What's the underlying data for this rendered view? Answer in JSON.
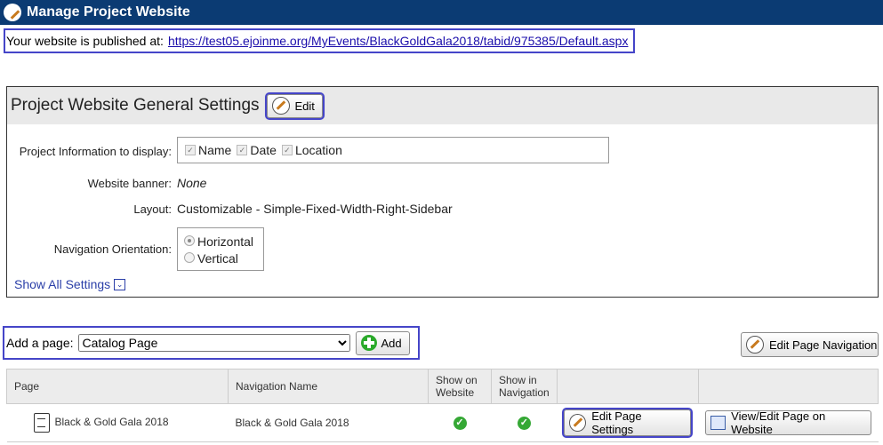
{
  "header": {
    "title": "Manage Project Website"
  },
  "publish": {
    "text": "Your website is published at:",
    "url": "https://test05.ejoinme.org/MyEvents/BlackGoldGala2018/tabid/975385/Default.aspx"
  },
  "general": {
    "title": "Project Website General Settings",
    "edit_label": "Edit",
    "info_label": "Project Information to display:",
    "info_options": [
      "Name",
      "Date",
      "Location"
    ],
    "banner_label": "Website banner:",
    "banner_value": "None",
    "layout_label": "Layout:",
    "layout_value": "Customizable - Simple-Fixed-Width-Right-Sidebar",
    "nav_label": "Navigation Orientation:",
    "nav_options": [
      "Horizontal",
      "Vertical"
    ],
    "show_all": "Show All Settings"
  },
  "addpage": {
    "label": "Add a page:",
    "selected": "Catalog Page",
    "add_label": "Add"
  },
  "edit_nav_label": "Edit Page Navigation",
  "table": {
    "headers": [
      "Page",
      "Navigation Name",
      "Show on Website",
      "Show in Navigation"
    ],
    "rows": [
      {
        "page": "Black & Gold Gala 2018",
        "nav_name": "Black & Gold Gala 2018",
        "edit_label": "Edit Page Settings",
        "view_label": "View/Edit Page on Website"
      }
    ]
  }
}
